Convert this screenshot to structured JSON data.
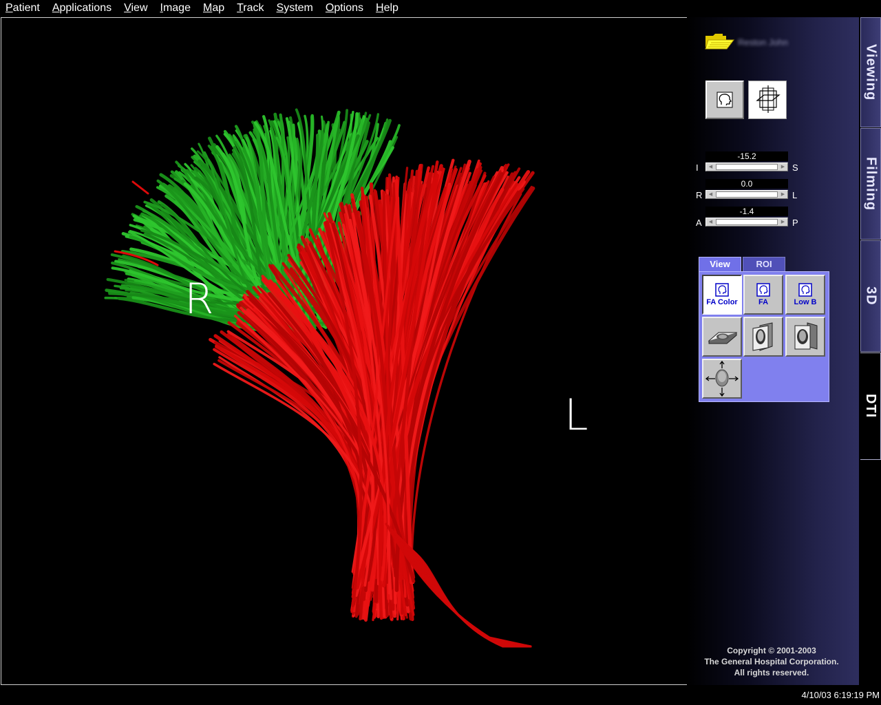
{
  "menu": [
    "Patient",
    "Applications",
    "View",
    "Image",
    "Map",
    "Track",
    "System",
    "Options",
    "Help"
  ],
  "viewport": {
    "orientation_right": "R",
    "orientation_left": "L"
  },
  "panel": {
    "patient_name": "Reston John",
    "sliders": [
      {
        "value": "-15.2",
        "left": "I",
        "right": "S"
      },
      {
        "value": "0.0",
        "left": "R",
        "right": "L"
      },
      {
        "value": "-1.4",
        "left": "A",
        "right": "P"
      }
    ],
    "view_tabs": [
      "View",
      "ROI"
    ],
    "view_buttons": [
      "FA Color",
      "FA",
      "Low B"
    ],
    "copyright": [
      "Copyright © 2001-2003",
      "The General Hospital Corporation.",
      "All rights reserved."
    ]
  },
  "side_tabs": [
    "Viewing",
    "Filming",
    "3D",
    "DTI"
  ],
  "status": {
    "datetime": "4/10/03 6:19:19 PM"
  },
  "icons": [
    "folder-icon",
    "head-outline-icon",
    "orthogonal-planes-icon",
    "axial-slice-icon",
    "sagittal-slice-icon",
    "coronal-slice-icon",
    "head-rotate-icon"
  ],
  "colors": {
    "fiber_green": "#22b022",
    "fiber_red": "#dd0a0a",
    "panel_accent": "#7070e8"
  }
}
